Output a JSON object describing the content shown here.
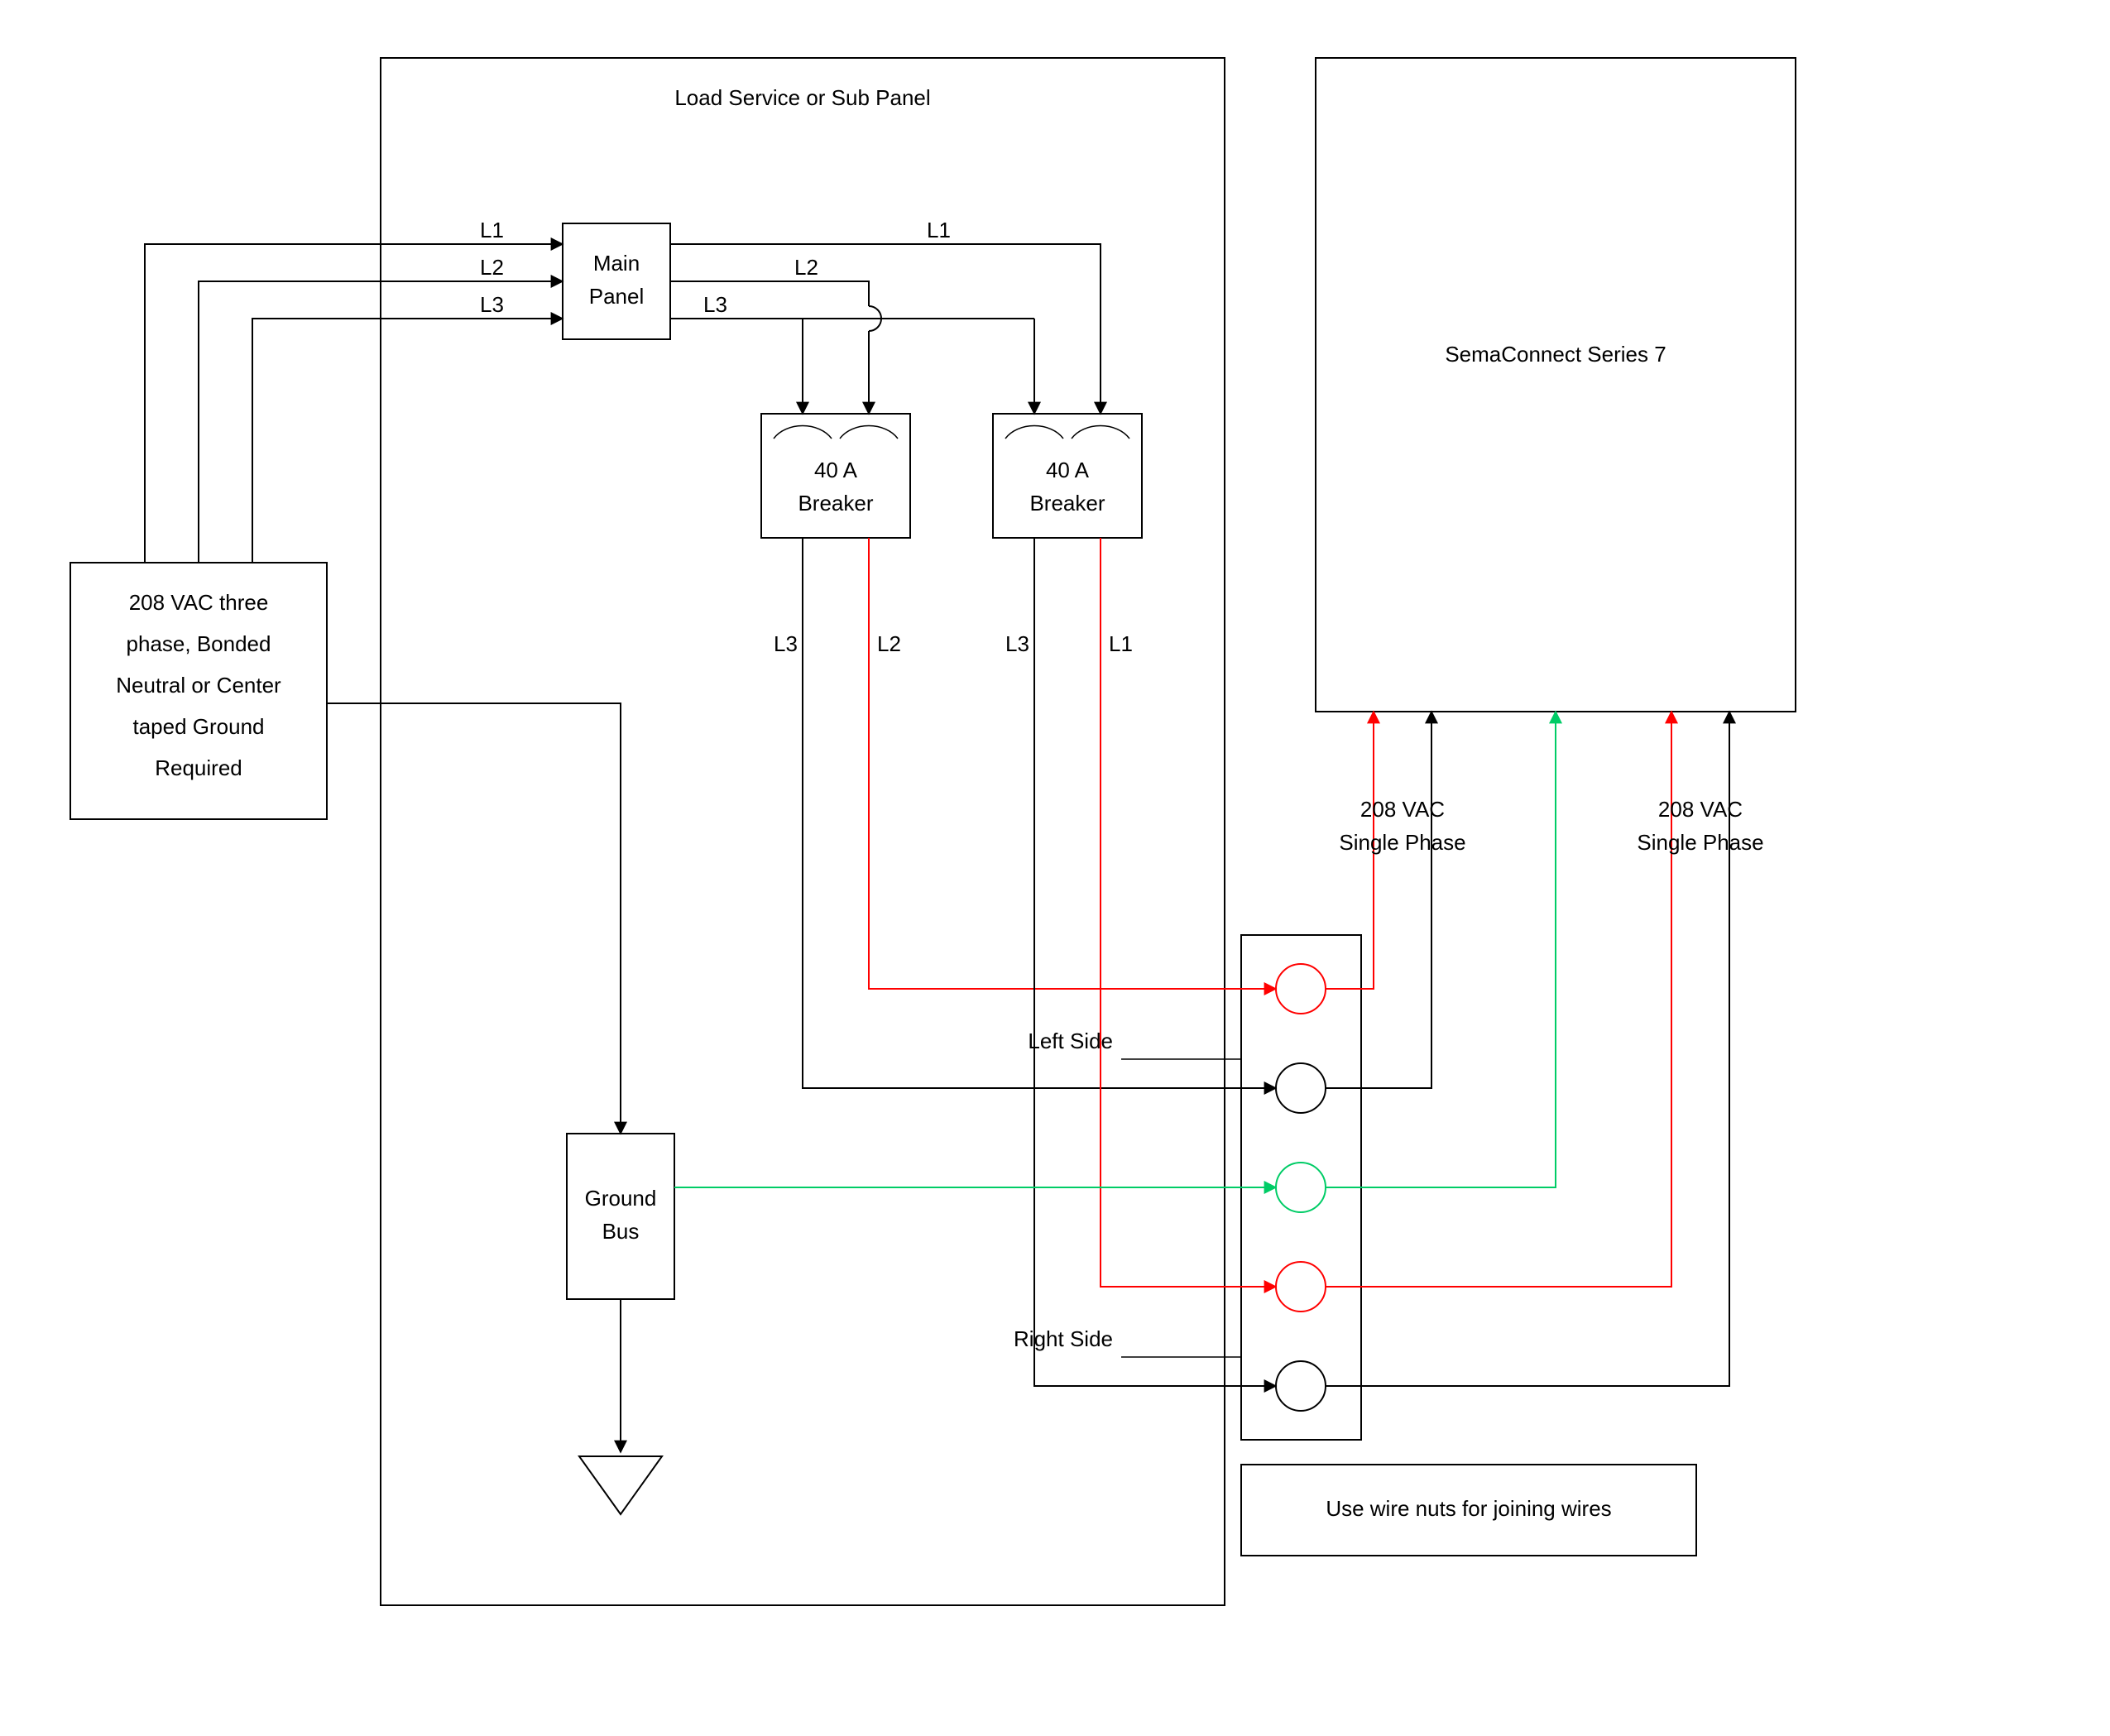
{
  "diagram": {
    "panel_title": "Load Service or Sub Panel",
    "supply": {
      "line1": "208 VAC three",
      "line2": "phase, Bonded",
      "line3": "Neutral or Center",
      "line4": "taped Ground",
      "line5": "Required"
    },
    "main_panel": {
      "line1": "Main",
      "line2": "Panel"
    },
    "breaker_left": {
      "line1": "40 A",
      "line2": "Breaker"
    },
    "breaker_right": {
      "line1": "40 A",
      "line2": "Breaker"
    },
    "ground_bus": {
      "line1": "Ground",
      "line2": "Bus"
    },
    "phase": {
      "l1": "L1",
      "l2": "L2",
      "l3": "L3"
    },
    "sides": {
      "left": "Left Side",
      "right": "Right Side"
    },
    "sema": "SemaConnect Series 7",
    "phase_label": {
      "line1": "208 VAC",
      "line2": "Single Phase"
    },
    "wire_nuts": "Use wire nuts for joining wires"
  },
  "colors": {
    "black": "#000000",
    "red": "#ff0000",
    "green": "#00cc66"
  }
}
